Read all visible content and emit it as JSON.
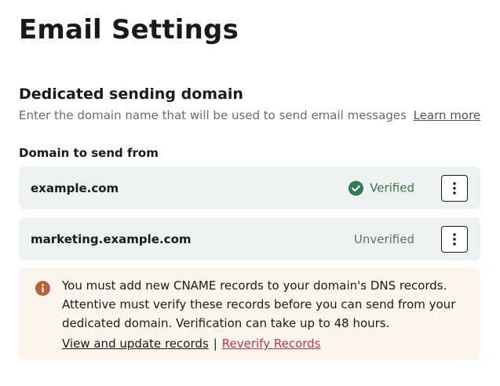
{
  "page": {
    "title": "Email Settings"
  },
  "section": {
    "title": "Dedicated sending domain",
    "description": "Enter the domain name that will be used to send email messages",
    "learn_more_label": "Learn more"
  },
  "domains": {
    "label": "Domain to send from",
    "rows": [
      {
        "name": "example.com",
        "status": "Verified",
        "status_color": "#2e7d4f",
        "status_icon": "check-circle-icon"
      },
      {
        "name": "marketing.example.com",
        "status": "Unverified",
        "status_color": "#6b6b6b"
      }
    ],
    "more_icon": "vertical-ellipsis-icon"
  },
  "alert": {
    "icon": "info-icon",
    "icon_color": "#b5613a",
    "message": "You must add new CNAME records to your domain's DNS records. Attentive must verify these records before you can send from your dedicated domain. Verification can take up to 48 hours.",
    "view_link_label": "View and update records",
    "separator": "|",
    "reverify_link_label": "Reverify Records",
    "reverify_color": "#c2344a",
    "background_color": "#faf5ed"
  }
}
